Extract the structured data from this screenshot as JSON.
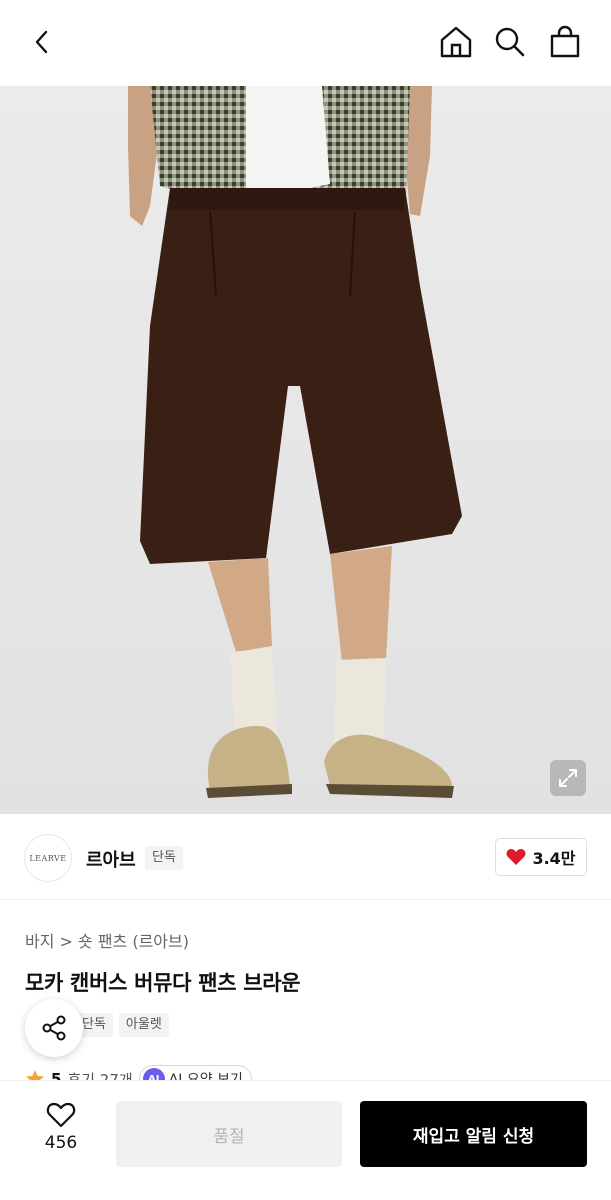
{
  "header": {
    "back_icon": "chevron-left-icon",
    "home_icon": "home-icon",
    "search_icon": "search-icon",
    "cart_icon": "shopping-bag-icon"
  },
  "hero": {
    "expand_icon": "expand-icon"
  },
  "brand": {
    "logo_text": "LEARVE",
    "name": "르아브",
    "badge": "단독",
    "like_count": "3.4만",
    "like_icon": "heart-filled-icon",
    "like_color": "#e0192c"
  },
  "product": {
    "breadcrumb": "바지 > 숏 팬츠 (르아브)",
    "title": "모카 캔버스 버뮤다 팬츠 브라운",
    "tags": [
      "단독",
      "아울렛"
    ],
    "rating": "5",
    "reviews": "후기 27개",
    "ai_badge": "AI",
    "ai_label": "AI 요약 보기"
  },
  "bottom": {
    "wish_count": "456",
    "soldout_label": "품절",
    "restock_label": "재입고 알림 신청"
  },
  "colors": {
    "accent_purple": "#6b5cf0",
    "star_orange": "#f2a33a",
    "cta_black": "#000000"
  }
}
